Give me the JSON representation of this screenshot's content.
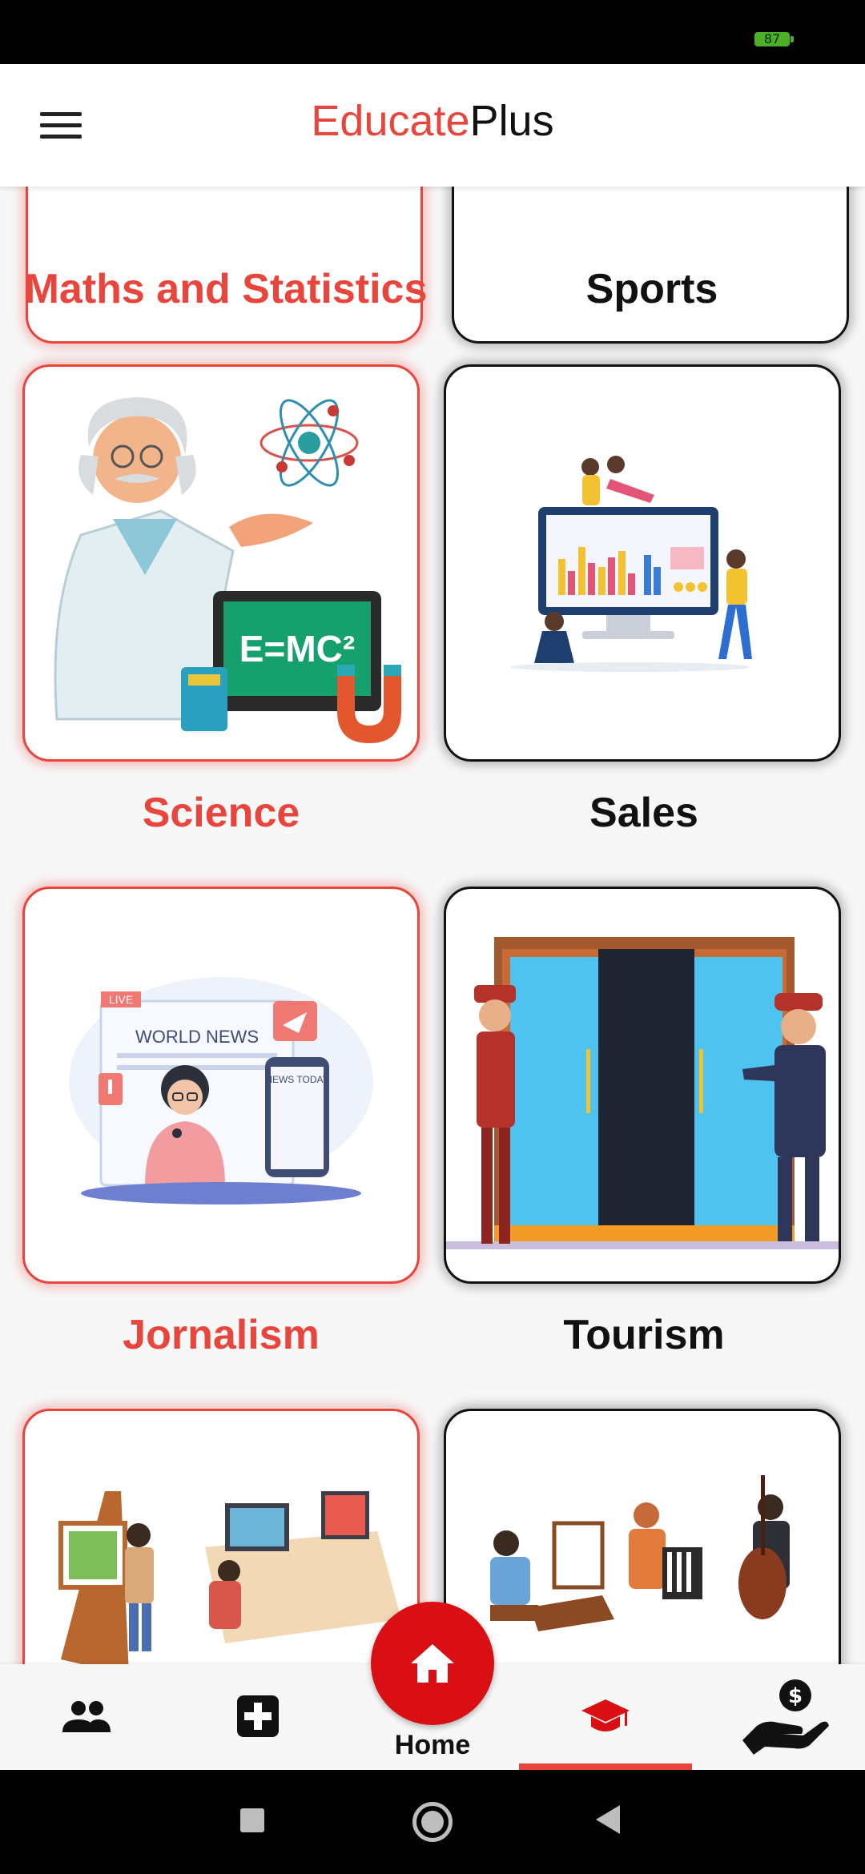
{
  "status_bar": {
    "battery": "87"
  },
  "app_bar": {
    "brand_part1": "Educate",
    "brand_part2": "Plus"
  },
  "categories": [
    {
      "label": "Maths and Statistics",
      "selected": true
    },
    {
      "label": "Sports",
      "selected": false
    },
    {
      "label": "Science",
      "selected": true
    },
    {
      "label": "Sales",
      "selected": false
    },
    {
      "label": "Jornalism",
      "selected": true
    },
    {
      "label": "Tourism",
      "selected": false
    },
    {
      "label": "",
      "selected": true
    },
    {
      "label": "",
      "selected": false
    }
  ],
  "illustration_text": {
    "formula": "E=MC²",
    "live": "LIVE",
    "world_news": "WORLD NEWS",
    "news_today": "NEWS TODAY"
  },
  "bottom_nav": {
    "items": [
      "people-icon",
      "medical-cross-icon",
      "home-icon",
      "graduation-cap-icon",
      "money-hand-icon"
    ],
    "home_label": "Home",
    "active": "graduation-cap-icon"
  },
  "colors": {
    "accent": "#e8453c",
    "fab": "#d90f14",
    "text": "#111111"
  }
}
